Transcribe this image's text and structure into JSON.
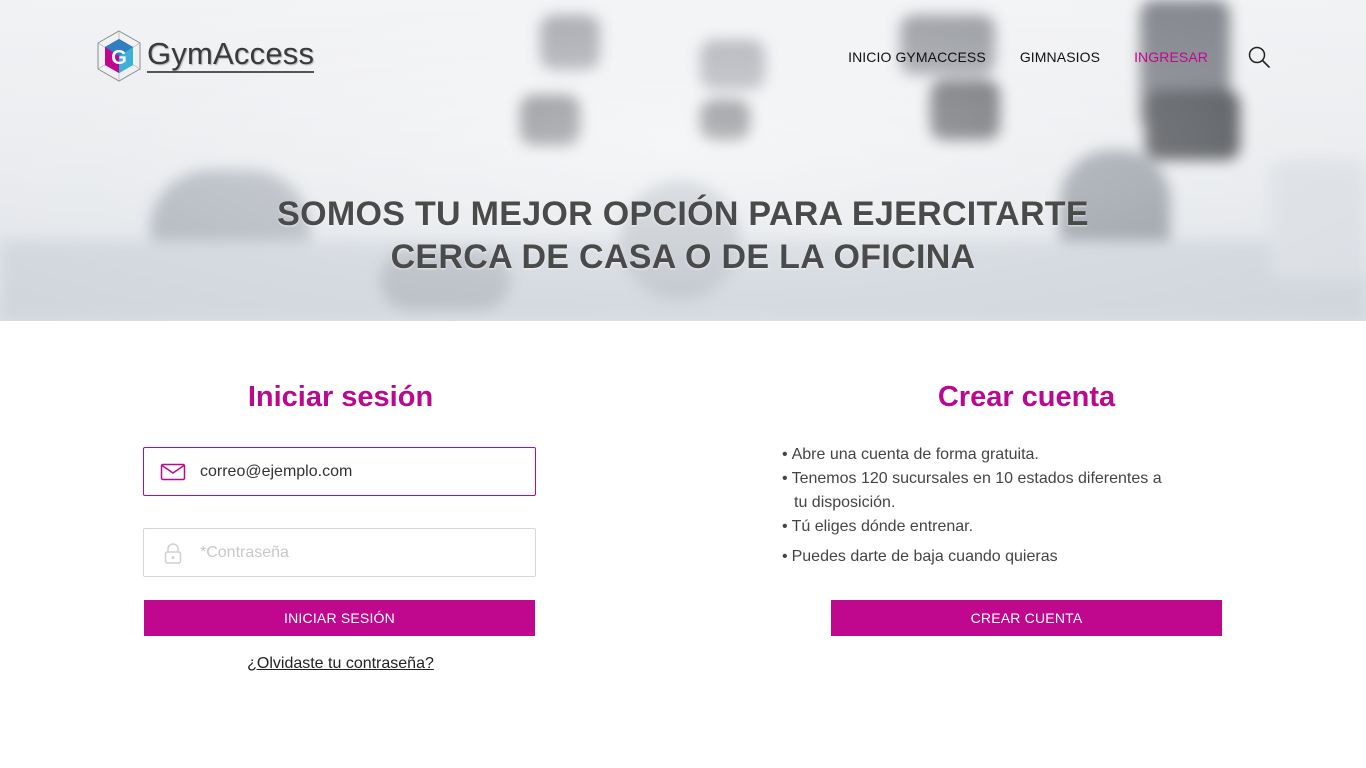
{
  "brand": {
    "name": "GymAccess",
    "accent": "#c0088f"
  },
  "nav": {
    "items": [
      {
        "label": "INICIO GYMACCESS",
        "active": false
      },
      {
        "label": "GIMNASIOS",
        "active": false
      },
      {
        "label": "INGRESAR",
        "active": true
      }
    ],
    "search_icon": "search-icon"
  },
  "hero": {
    "line1": "SOMOS TU MEJOR OPCIÓN PARA EJERCITARTE",
    "line2": "CERCA DE CASA O DE LA OFICINA"
  },
  "login": {
    "title": "Iniciar sesión",
    "email_value": "correo@ejemplo.com",
    "email_icon": "envelope-icon",
    "password_placeholder": "*Contraseña",
    "password_icon": "lock-icon",
    "button_label": "INICIAR SESIÓN",
    "forgot_label": "¿Olvidaste tu contraseña?"
  },
  "create": {
    "title": "Crear cuenta",
    "benefits": [
      "Abre una cuenta de forma gratuita.",
      "Tenemos 120 sucursales en 10 estados diferentes a",
      "tu disposición.",
      "Tú eliges dónde entrenar.",
      "Puedes darte de baja cuando quieras"
    ],
    "button_label": "CREAR CUENTA"
  }
}
